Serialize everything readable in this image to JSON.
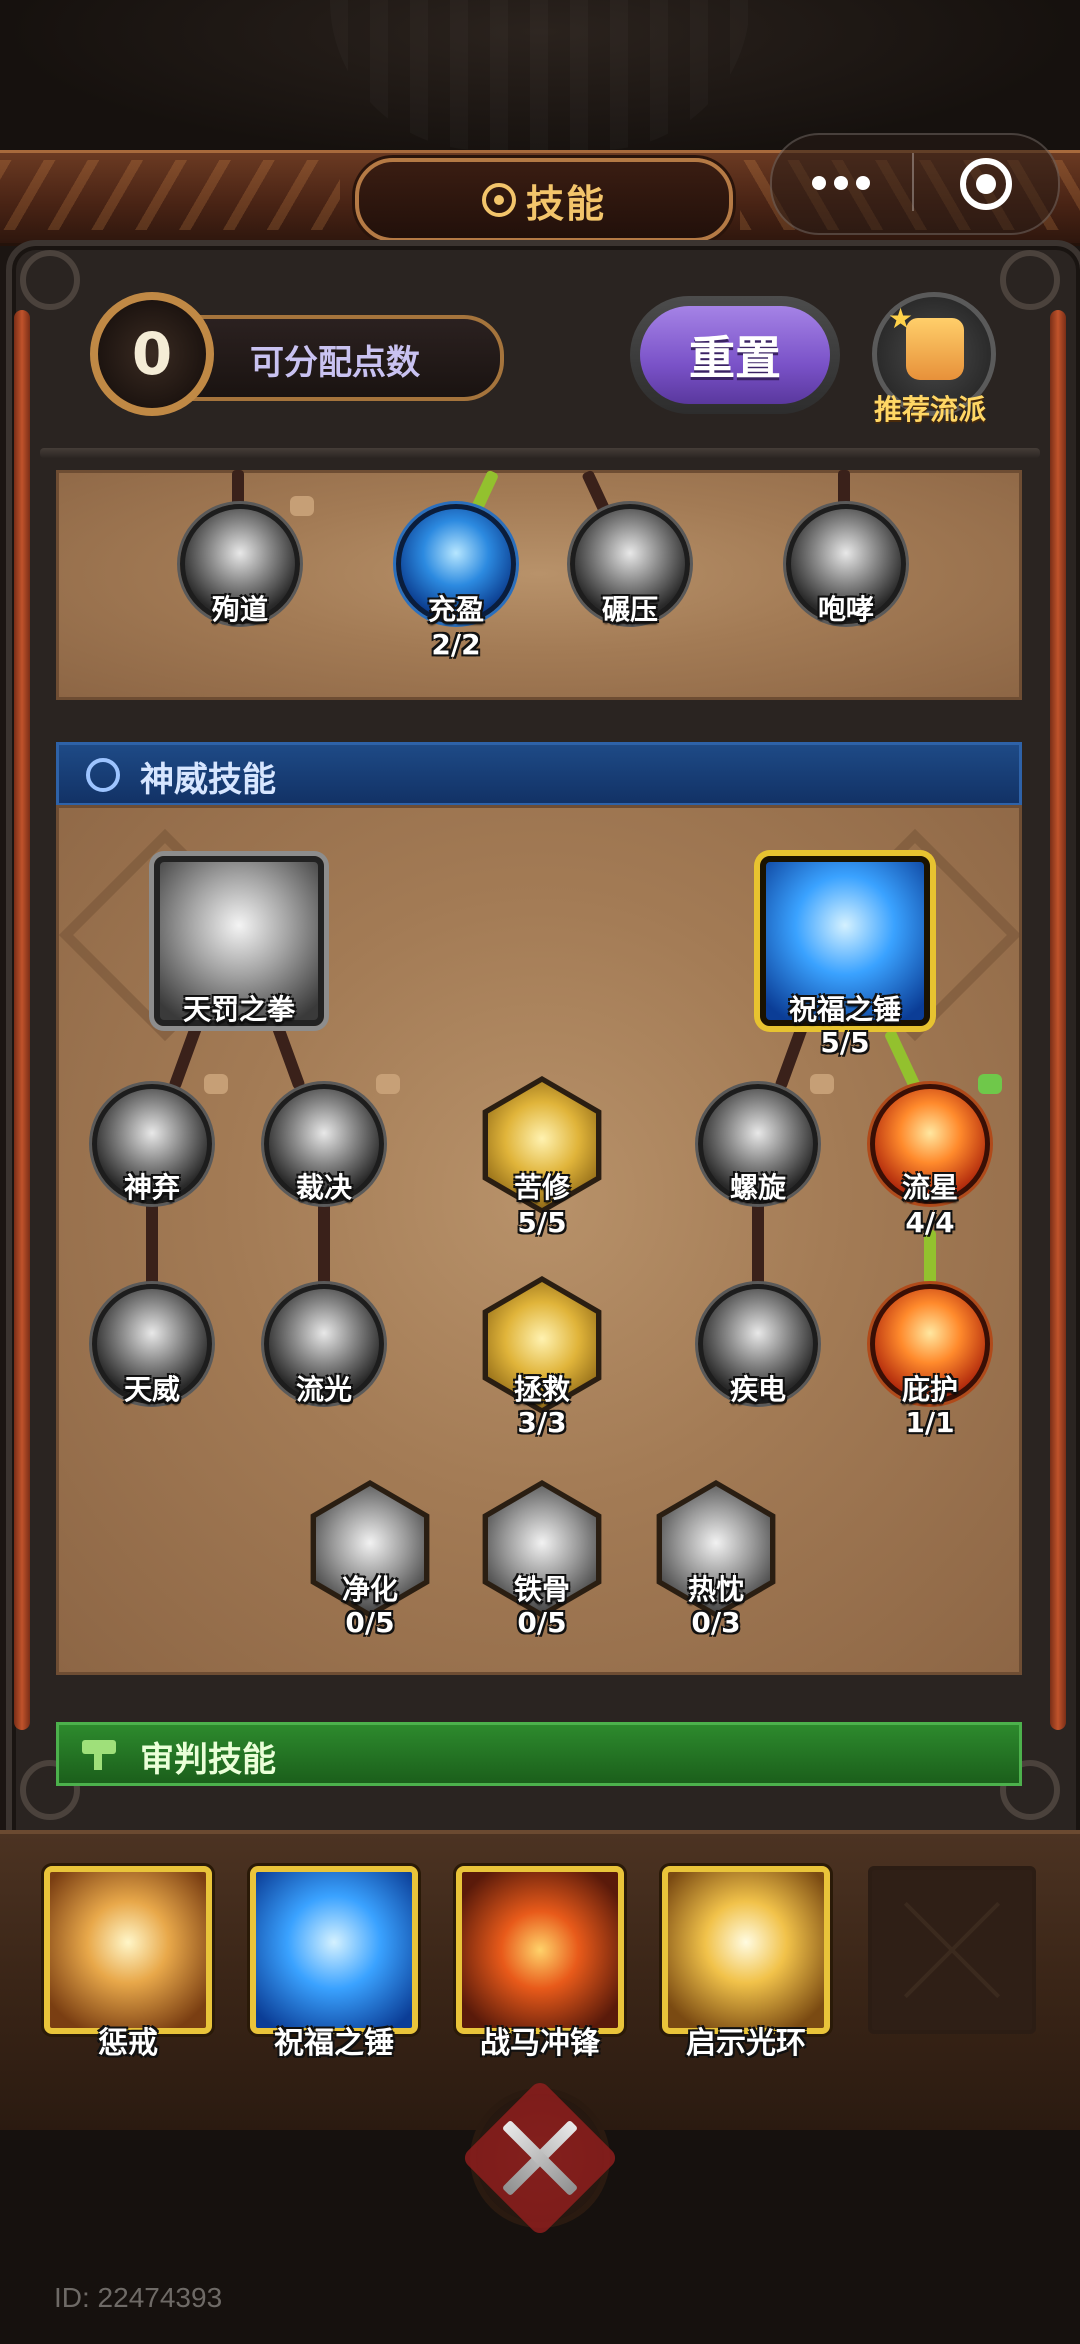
{
  "header": {
    "title": "技能",
    "wheel_icon": "wheel-icon"
  },
  "capsule": {
    "more_icon": "more-dots-icon",
    "close_icon": "close-target-icon"
  },
  "points": {
    "value": "0",
    "label": "可分配点数"
  },
  "buttons": {
    "reset": "重置",
    "recommend": "推荐流派"
  },
  "top_row": [
    {
      "name": "殉道",
      "level": ""
    },
    {
      "name": "充盈",
      "level": "2/2"
    },
    {
      "name": "碾压",
      "level": ""
    },
    {
      "name": "咆哮",
      "level": ""
    }
  ],
  "section_divine": {
    "title": "神威技能",
    "major": [
      {
        "name": "天罚之拳",
        "level": ""
      },
      {
        "name": "祝福之锤",
        "level": "5/5"
      }
    ],
    "row1": [
      {
        "name": "神弃",
        "level": ""
      },
      {
        "name": "裁决",
        "level": ""
      },
      {
        "name": "苦修",
        "level": "5/5"
      },
      {
        "name": "螺旋",
        "level": ""
      },
      {
        "name": "流星",
        "level": "4/4"
      }
    ],
    "row2": [
      {
        "name": "天威",
        "level": ""
      },
      {
        "name": "流光",
        "level": ""
      },
      {
        "name": "拯救",
        "level": "3/3"
      },
      {
        "name": "疾电",
        "level": ""
      },
      {
        "name": "庇护",
        "level": "1/1"
      }
    ],
    "row3": [
      {
        "name": "净化",
        "level": "0/5"
      },
      {
        "name": "铁骨",
        "level": "0/5"
      },
      {
        "name": "热忱",
        "level": "0/3"
      }
    ]
  },
  "section_judgement": {
    "title": "审判技能"
  },
  "equipped_slots": [
    {
      "name": "惩戒"
    },
    {
      "name": "祝福之锤"
    },
    {
      "name": "战马冲锋"
    },
    {
      "name": "启示光环"
    }
  ],
  "footer": {
    "id_text": "ID: 22474393"
  },
  "colors": {
    "accent_gold": "#e9c43a",
    "connector_active": "#93c12e",
    "divine_header": "#1e4a86",
    "judgement_header": "#2d8a2d",
    "reset_button": "#8a64d6"
  }
}
